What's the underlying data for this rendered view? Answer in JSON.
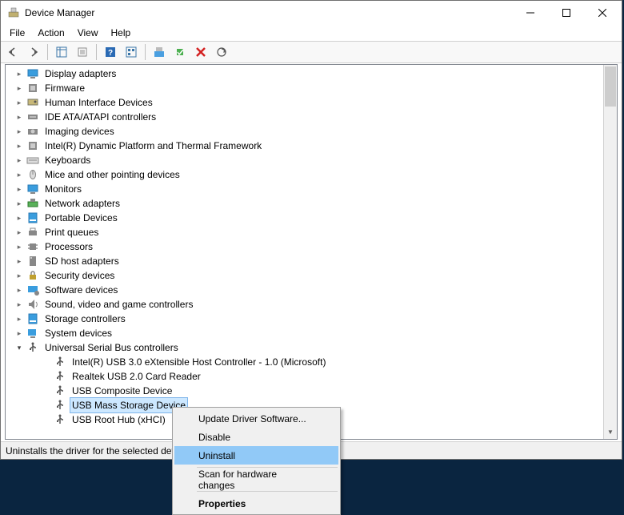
{
  "window": {
    "title": "Device Manager",
    "min_tip": "Minimize",
    "max_tip": "Maximize",
    "close_tip": "Close"
  },
  "menu": {
    "file": "File",
    "action": "Action",
    "view": "View",
    "help": "Help"
  },
  "toolbar": {
    "back": "Back",
    "forward": "Forward",
    "show_hide": "Show/Hide Console Tree",
    "properties": "Properties",
    "help": "Help",
    "view_icon": "View",
    "update": "Update Driver Software",
    "uninstall": "Uninstall",
    "disable": "Disable",
    "scan": "Scan for hardware changes"
  },
  "categories": [
    {
      "label": "Display adapters",
      "icon": "display"
    },
    {
      "label": "Firmware",
      "icon": "chip"
    },
    {
      "label": "Human Interface Devices",
      "icon": "hid"
    },
    {
      "label": "IDE ATA/ATAPI controllers",
      "icon": "ide"
    },
    {
      "label": "Imaging devices",
      "icon": "camera"
    },
    {
      "label": "Intel(R) Dynamic Platform and Thermal Framework",
      "icon": "chip"
    },
    {
      "label": "Keyboards",
      "icon": "keyboard"
    },
    {
      "label": "Mice and other pointing devices",
      "icon": "mouse"
    },
    {
      "label": "Monitors",
      "icon": "display"
    },
    {
      "label": "Network adapters",
      "icon": "network"
    },
    {
      "label": "Portable Devices",
      "icon": "storage"
    },
    {
      "label": "Print queues",
      "icon": "printer"
    },
    {
      "label": "Processors",
      "icon": "cpu"
    },
    {
      "label": "SD host adapters",
      "icon": "sd"
    },
    {
      "label": "Security devices",
      "icon": "lock"
    },
    {
      "label": "Software devices",
      "icon": "software"
    },
    {
      "label": "Sound, video and game controllers",
      "icon": "audio"
    },
    {
      "label": "Storage controllers",
      "icon": "storage"
    },
    {
      "label": "System devices",
      "icon": "system"
    }
  ],
  "usb_category": {
    "label": "Universal Serial Bus controllers",
    "children": [
      {
        "label": "Intel(R) USB 3.0 eXtensible Host Controller - 1.0 (Microsoft)"
      },
      {
        "label": "Realtek USB 2.0 Card Reader"
      },
      {
        "label": "USB Composite Device"
      },
      {
        "label": "USB Mass Storage Device",
        "selected": true
      },
      {
        "label": "USB Root Hub (xHCI)"
      }
    ]
  },
  "context_menu": {
    "update": "Update Driver Software...",
    "disable": "Disable",
    "uninstall": "Uninstall",
    "scan": "Scan for hardware changes",
    "properties": "Properties"
  },
  "statusbar": {
    "text": "Uninstalls the driver for the selected device."
  }
}
